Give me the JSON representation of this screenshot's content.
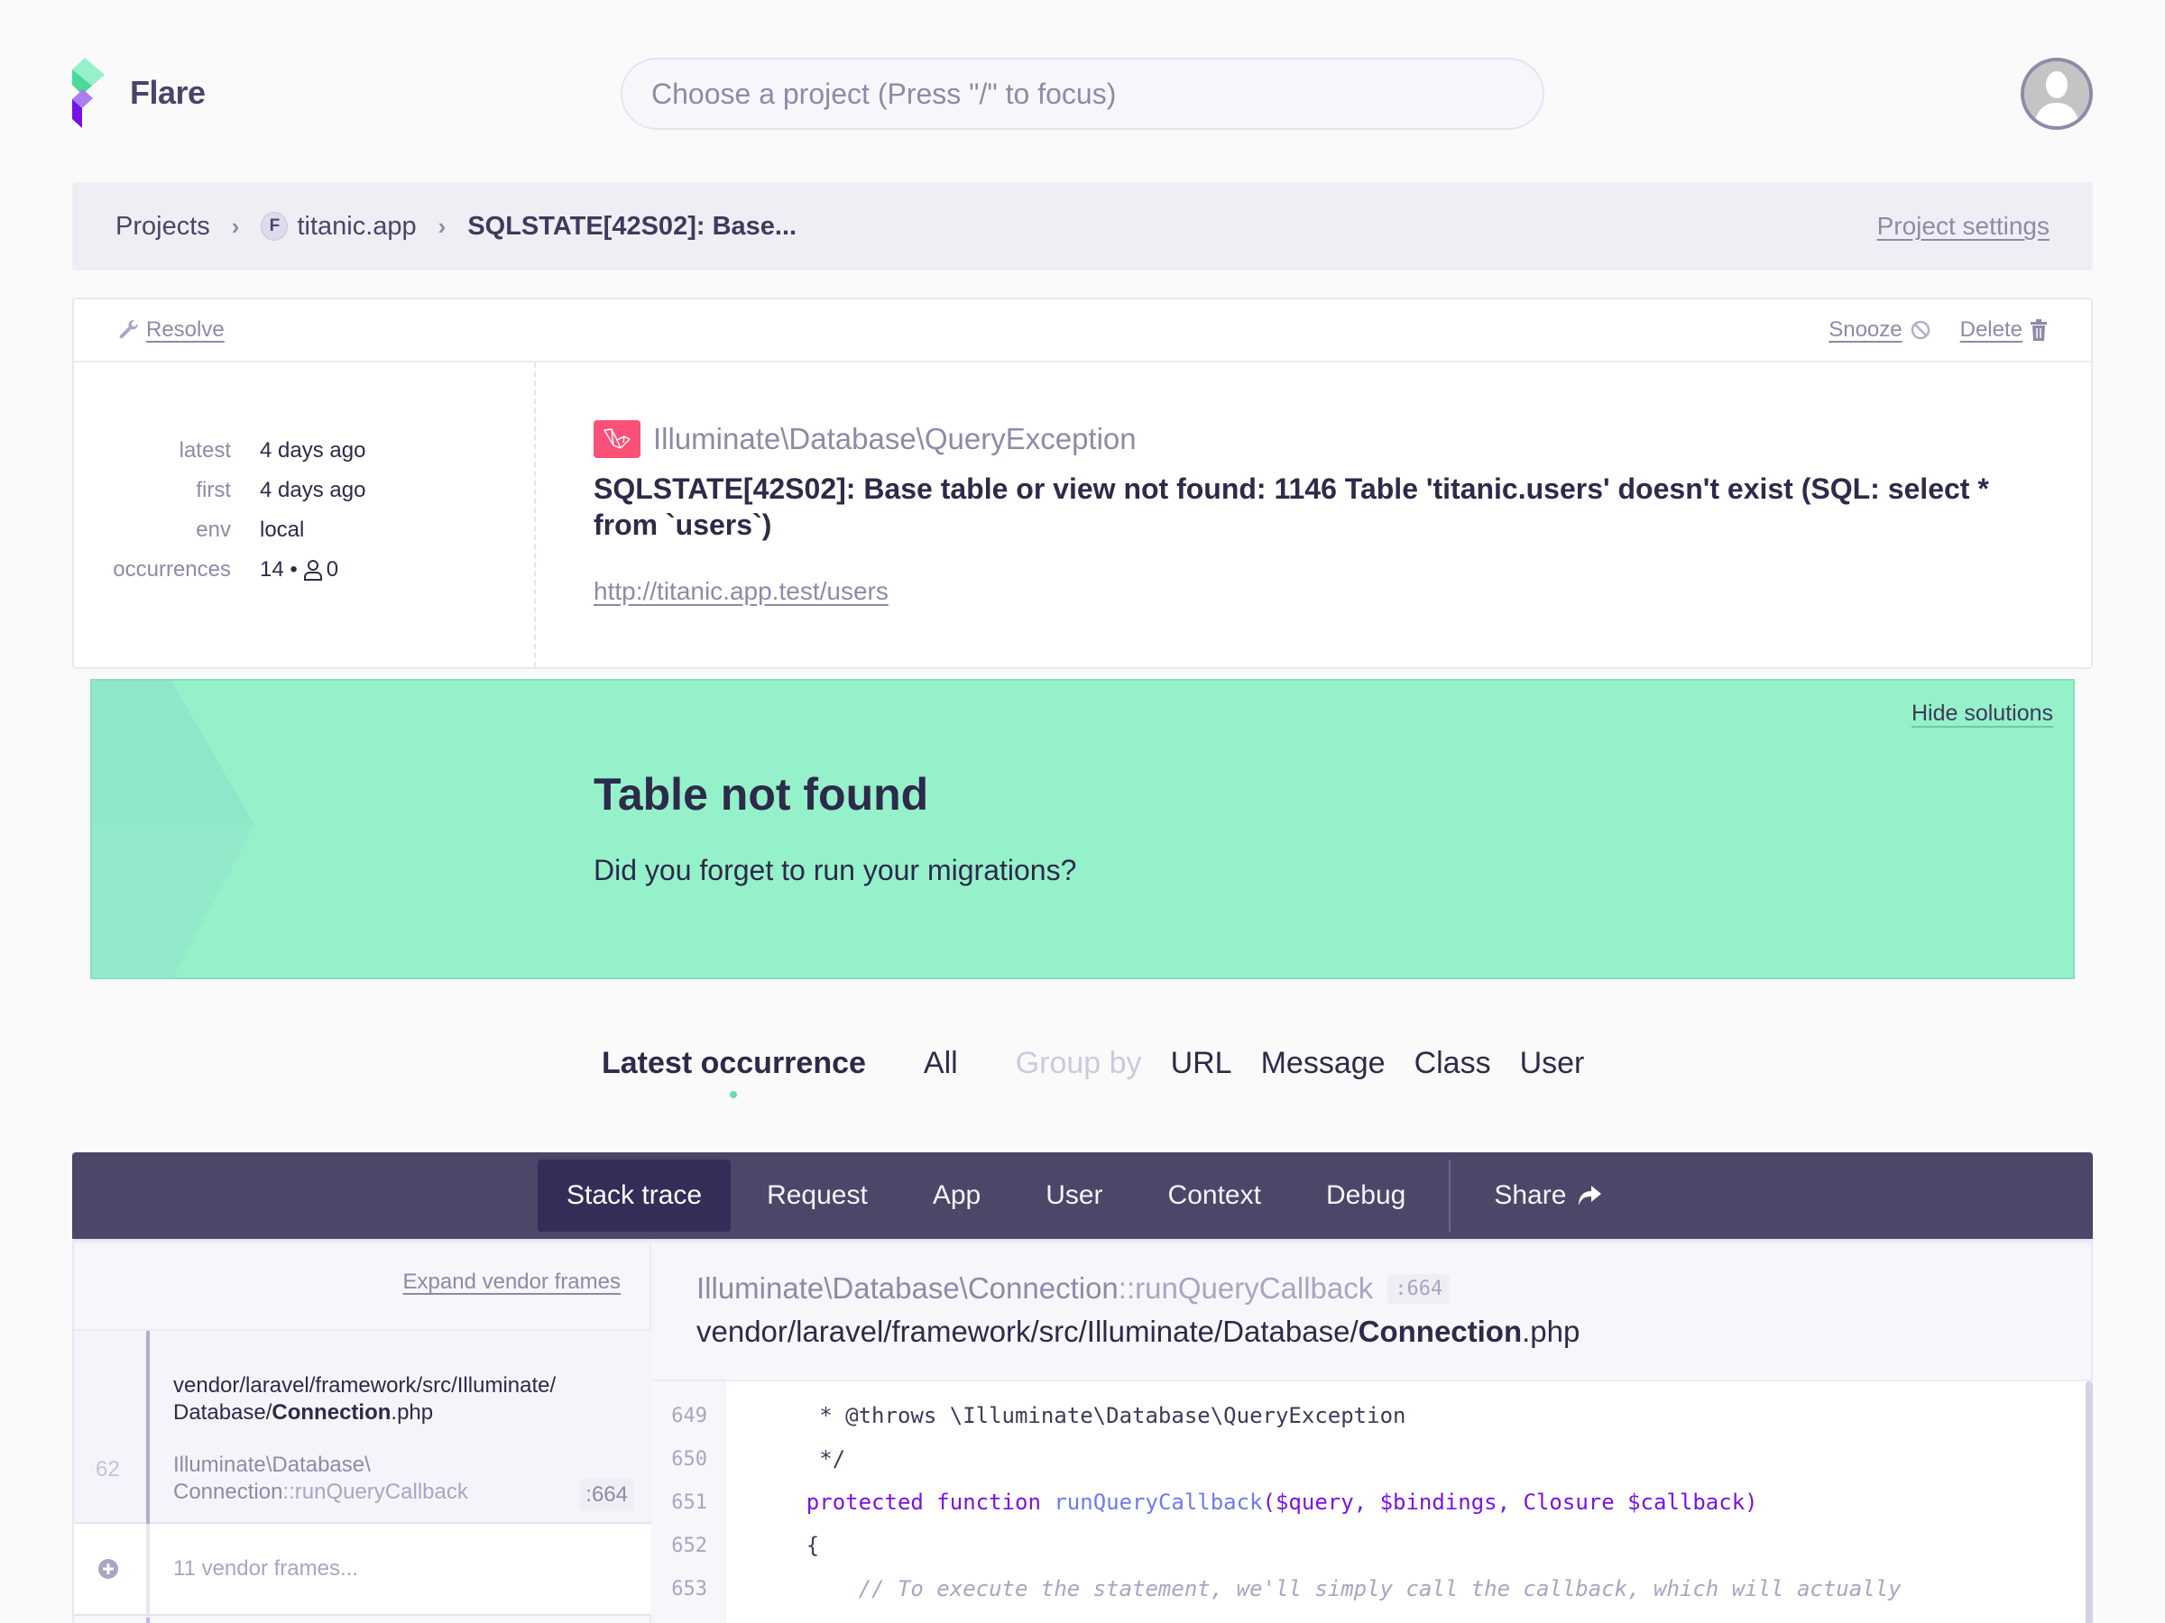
{
  "app": {
    "brand": "Flare"
  },
  "search": {
    "placeholder": "Choose a project (Press \"/\" to focus)"
  },
  "breadcrumb": {
    "items": [
      {
        "label": "Projects"
      },
      {
        "label": "titanic.app",
        "badge": "F"
      },
      {
        "label": "SQLSTATE[42S02]: Base..."
      }
    ],
    "settings_label": "Project settings"
  },
  "error_card": {
    "actions": {
      "resolve": "Resolve",
      "snooze": "Snooze",
      "delete": "Delete"
    },
    "meta": [
      {
        "key": "latest",
        "value": "4 days ago"
      },
      {
        "key": "first",
        "value": "4 days ago"
      },
      {
        "key": "env",
        "value": "local"
      },
      {
        "key": "occurrences",
        "value": "14 •",
        "users": "0"
      }
    ],
    "exception_class": "Illuminate\\Database\\QueryException",
    "message": "SQLSTATE[42S02]: Base table or view not found: 1146 Table 'titanic.users' doesn't exist (SQL: select * from `users`)",
    "url": "http://titanic.app.test/users"
  },
  "solution": {
    "hide_label": "Hide solutions",
    "title": "Table not found",
    "description": "Did you forget to run your migrations?"
  },
  "filters": {
    "items": [
      {
        "label": "Latest occurrence",
        "active": true
      },
      {
        "label": "All",
        "active": false
      }
    ],
    "group_by_label": "Group by",
    "group_by": [
      "URL",
      "Message",
      "Class",
      "User"
    ]
  },
  "tabs": {
    "items": [
      {
        "label": "Stack trace",
        "active": true
      },
      {
        "label": "Request"
      },
      {
        "label": "App"
      },
      {
        "label": "User"
      },
      {
        "label": "Context"
      },
      {
        "label": "Debug"
      }
    ],
    "share_label": "Share"
  },
  "stack": {
    "expand_vendor_label": "Expand vendor frames",
    "active_frame": {
      "number": "62",
      "file_prefix": "vendor/laravel/framework/src/Illuminate/ Database/",
      "file_name": "Connection",
      "file_ext": ".php",
      "class": "Illuminate\\Database\\ Connection",
      "method": "::runQueryCallback",
      "line": ":664"
    },
    "vendor_frames_label": "11 vendor frames..."
  },
  "code": {
    "header_class": "Illuminate\\Database\\Connection",
    "header_method": "::runQueryCallback",
    "header_line": ":664",
    "file_prefix": "vendor/laravel/framework/src/Illuminate/Database/",
    "file_name": "Connection",
    "file_ext": ".php",
    "lines": [
      {
        "number": "649",
        "text": "     * @throws \\Illuminate\\Database\\QueryException"
      },
      {
        "number": "650",
        "text": "     */"
      },
      {
        "number": "651",
        "kw1": "protected",
        "kw2": "function",
        "fn": "runQueryCallback",
        "args": "($query, $bindings, Closure $callback)"
      },
      {
        "number": "652",
        "text": "    {"
      },
      {
        "number": "653",
        "comment": "        // To execute the statement, we'll simply call the callback, which will actually"
      }
    ]
  },
  "colors": {
    "accent_green": "#95f1ca",
    "tabbar": "#4a4769",
    "tab_active": "#332d58",
    "laravel_red": "#fb5078",
    "keyword_purple": "#7a12e6"
  }
}
